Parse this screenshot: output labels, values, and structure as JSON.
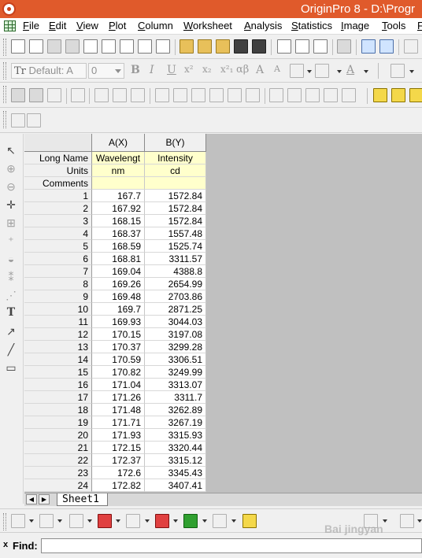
{
  "window": {
    "title": "OriginPro 8 - D:\\Progr"
  },
  "menu": [
    "File",
    "Edit",
    "View",
    "Plot",
    "Column",
    "Worksheet",
    "Analysis",
    "Statistics",
    "Image",
    "Tools",
    "F"
  ],
  "format_toolbar": {
    "font_value": "Default: A",
    "font_icon": "Tr",
    "size_value": "0",
    "bold": "B",
    "italic": "I",
    "underline": "U",
    "superscript": "x²",
    "subscript": "x₂",
    "supersub": "x²₁",
    "greek": "αβ",
    "increase_font": "A",
    "decrease_font": "A"
  },
  "worksheet": {
    "columns": [
      {
        "header": "A(X)",
        "long_name": "Wavelengt",
        "units": "nm",
        "comments": ""
      },
      {
        "header": "B(Y)",
        "long_name": "Intensity",
        "units": "cd",
        "comments": ""
      }
    ],
    "row_labels": {
      "long_name": "Long Name",
      "units": "Units",
      "comments": "Comments"
    },
    "rows": [
      {
        "n": "1",
        "a": "167.7",
        "b": "1572.84"
      },
      {
        "n": "2",
        "a": "167.92",
        "b": "1572.84"
      },
      {
        "n": "3",
        "a": "168.15",
        "b": "1572.84"
      },
      {
        "n": "4",
        "a": "168.37",
        "b": "1557.48"
      },
      {
        "n": "5",
        "a": "168.59",
        "b": "1525.74"
      },
      {
        "n": "6",
        "a": "168.81",
        "b": "3311.57"
      },
      {
        "n": "7",
        "a": "169.04",
        "b": "4388.8"
      },
      {
        "n": "8",
        "a": "169.26",
        "b": "2654.99"
      },
      {
        "n": "9",
        "a": "169.48",
        "b": "2703.86"
      },
      {
        "n": "10",
        "a": "169.7",
        "b": "2871.25"
      },
      {
        "n": "11",
        "a": "169.93",
        "b": "3044.03"
      },
      {
        "n": "12",
        "a": "170.15",
        "b": "3197.08"
      },
      {
        "n": "13",
        "a": "170.37",
        "b": "3299.28"
      },
      {
        "n": "14",
        "a": "170.59",
        "b": "3306.51"
      },
      {
        "n": "15",
        "a": "170.82",
        "b": "3249.99"
      },
      {
        "n": "16",
        "a": "171.04",
        "b": "3313.07"
      },
      {
        "n": "17",
        "a": "171.26",
        "b": "3311.7"
      },
      {
        "n": "18",
        "a": "171.48",
        "b": "3262.89"
      },
      {
        "n": "19",
        "a": "171.71",
        "b": "3267.19"
      },
      {
        "n": "20",
        "a": "171.93",
        "b": "3315.93"
      },
      {
        "n": "21",
        "a": "172.15",
        "b": "3320.44"
      },
      {
        "n": "22",
        "a": "172.37",
        "b": "3315.12"
      },
      {
        "n": "23",
        "a": "172.6",
        "b": "3345.43"
      },
      {
        "n": "24",
        "a": "172.82",
        "b": "3407.41"
      }
    ],
    "sheet_tab": "Sheet1"
  },
  "left_tools": {
    "text_tool": "T"
  },
  "find": {
    "label": "Find:",
    "close": "x",
    "value": ""
  },
  "watermark": "Bai jingyan",
  "colors": {
    "title_bar": "#e05a2b",
    "meta_cell": "#ffffcc",
    "empty_area": "#c0c0c0"
  }
}
